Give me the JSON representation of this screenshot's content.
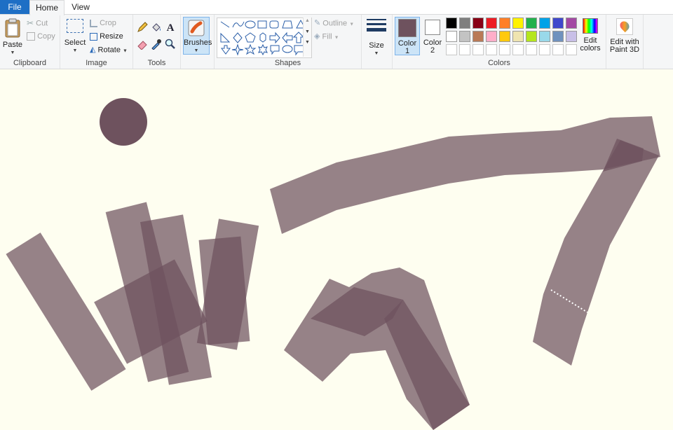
{
  "tabs": {
    "file": "File",
    "home": "Home",
    "view": "View"
  },
  "clipboard": {
    "paste": "Paste",
    "cut": "Cut",
    "copy": "Copy",
    "label": "Clipboard"
  },
  "image": {
    "select": "Select",
    "crop": "Crop",
    "resize": "Resize",
    "rotate": "Rotate",
    "label": "Image"
  },
  "tools": {
    "label": "Tools",
    "text_tool_glyph": "A"
  },
  "brushes": {
    "label": "Brushes"
  },
  "shapes": {
    "outline": "Outline",
    "fill": "Fill",
    "label": "Shapes"
  },
  "size": {
    "label": "Size"
  },
  "colors": {
    "color1": "Color 1",
    "color1_line1": "Color",
    "color1_line2": "1",
    "color2_line1": "Color",
    "color2_line2": "2",
    "edit_line1": "Edit",
    "edit_line2": "colors",
    "label": "Colors",
    "color1_value": "#6e525e",
    "color2_value": "#ffffff",
    "palette_row1": [
      "#000000",
      "#7f7f7f",
      "#880015",
      "#ed1c24",
      "#ff7f27",
      "#fff200",
      "#22b14c",
      "#00a2e8",
      "#3f48cc",
      "#a349a4"
    ],
    "palette_row2": [
      "#ffffff",
      "#c3c3c3",
      "#b97a57",
      "#ffaec9",
      "#ffc90e",
      "#efe4b0",
      "#b5e61d",
      "#99d9ea",
      "#7092be",
      "#c8bfe7"
    ]
  },
  "paint3d": {
    "line1": "Edit with",
    "line2": "Paint 3D"
  },
  "canvas": {
    "background": "#fefef0",
    "stroke_color": "#6e525e"
  }
}
